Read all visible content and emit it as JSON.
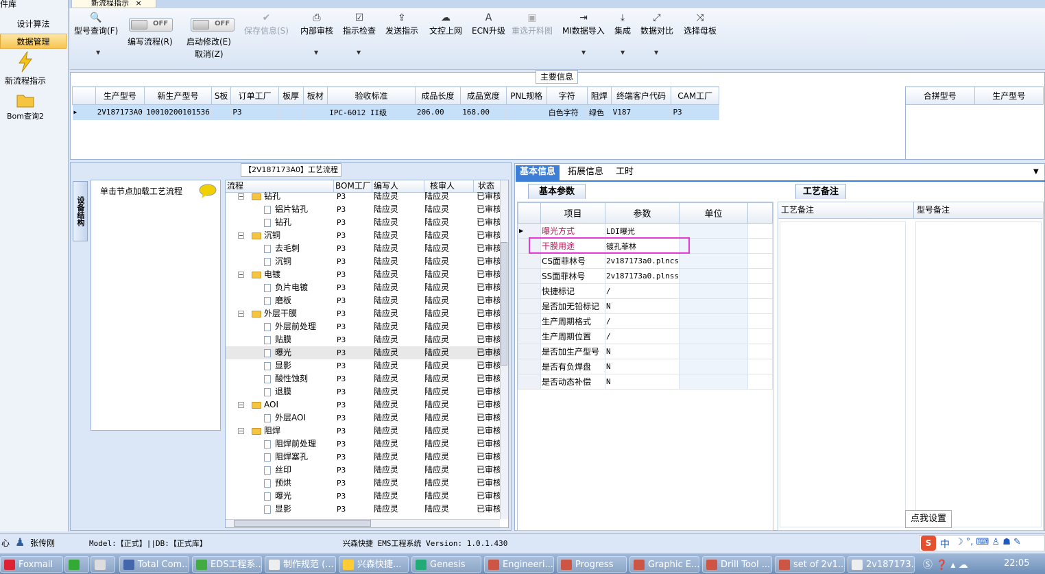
{
  "left_nav": {
    "title": "件库",
    "items": [
      {
        "label": "设计算法"
      },
      {
        "label": "数据管理"
      }
    ],
    "new_flow_label": "新流程指示",
    "bom_label": "Bom查询2"
  },
  "tab": {
    "label": "新流程指示",
    "close": "×"
  },
  "toolbar": {
    "model_query": "型号查询(F)",
    "edit_flow": "编写流程(R)",
    "off_label": "OFF",
    "start_modify": "启动修改(E)",
    "cancel": "取消(Z)",
    "save_info": "保存信息(S)",
    "internal_review": "内部审核",
    "check_instruction": "指示检查",
    "send_instruction": "发送指示",
    "doc_upload": "文控上网",
    "ecn_upgrade": "ECN升级",
    "reselect_material": "重选开料图",
    "mi_import": "MI数据导入",
    "integrate": "集成",
    "data_compare": "数据对比",
    "select_master": "选择母板"
  },
  "main_info": {
    "legend": "主要信息",
    "columns": [
      "生产型号",
      "新生产型号",
      "S板",
      "订单工厂",
      "板厚",
      "板材",
      "验收标准",
      "成品长度",
      "成品宽度",
      "PNL规格",
      "字符",
      "阻焊",
      "终端客户代码",
      "CAM工厂"
    ],
    "row": [
      "2V187173A0",
      "10010200101536",
      "",
      "P3",
      "",
      "",
      "IPC-6012 II级",
      "206.00",
      "168.00",
      "",
      "白色字符",
      "绿色",
      "V187",
      "P3"
    ],
    "right_columns": [
      "合拼型号",
      "生产型号"
    ]
  },
  "flow": {
    "legend": "【2V187173A0】工艺流程",
    "device_tab": "设备结构",
    "node_hint": "单击节点加载工艺流程",
    "headers": [
      "流程",
      "BOM工厂",
      "编写人",
      "核审人",
      "状态"
    ],
    "rows": [
      {
        "name": "钻孔",
        "level": 0,
        "folder": true,
        "f": "P3",
        "w": "陆应灵",
        "r": "陆应灵",
        "s": "已审核"
      },
      {
        "name": "铝片钻孔",
        "level": 1,
        "folder": false,
        "f": "P3",
        "w": "陆应灵",
        "r": "陆应灵",
        "s": "已审核"
      },
      {
        "name": "钻孔",
        "level": 1,
        "folder": false,
        "f": "P3",
        "w": "陆应灵",
        "r": "陆应灵",
        "s": "已审核"
      },
      {
        "name": "沉铜",
        "level": 0,
        "folder": true,
        "f": "P3",
        "w": "陆应灵",
        "r": "陆应灵",
        "s": "已审核"
      },
      {
        "name": "去毛刺",
        "level": 1,
        "folder": false,
        "f": "P3",
        "w": "陆应灵",
        "r": "陆应灵",
        "s": "已审核"
      },
      {
        "name": "沉铜",
        "level": 1,
        "folder": false,
        "f": "P3",
        "w": "陆应灵",
        "r": "陆应灵",
        "s": "已审核"
      },
      {
        "name": "电镀",
        "level": 0,
        "folder": true,
        "f": "P3",
        "w": "陆应灵",
        "r": "陆应灵",
        "s": "已审核"
      },
      {
        "name": "负片电镀",
        "level": 1,
        "folder": false,
        "f": "P3",
        "w": "陆应灵",
        "r": "陆应灵",
        "s": "已审核"
      },
      {
        "name": "磨板",
        "level": 1,
        "folder": false,
        "f": "P3",
        "w": "陆应灵",
        "r": "陆应灵",
        "s": "已审核"
      },
      {
        "name": "外层干膜",
        "level": 0,
        "folder": true,
        "f": "P3",
        "w": "陆应灵",
        "r": "陆应灵",
        "s": "已审核"
      },
      {
        "name": "外层前处理",
        "level": 1,
        "folder": false,
        "f": "P3",
        "w": "陆应灵",
        "r": "陆应灵",
        "s": "已审核"
      },
      {
        "name": "贴膜",
        "level": 1,
        "folder": false,
        "f": "P3",
        "w": "陆应灵",
        "r": "陆应灵",
        "s": "已审核"
      },
      {
        "name": "曝光",
        "level": 1,
        "folder": false,
        "f": "P3",
        "w": "陆应灵",
        "r": "陆应灵",
        "s": "已审核",
        "selected": true
      },
      {
        "name": "显影",
        "level": 1,
        "folder": false,
        "f": "P3",
        "w": "陆应灵",
        "r": "陆应灵",
        "s": "已审核"
      },
      {
        "name": "酸性蚀刻",
        "level": 1,
        "folder": false,
        "f": "P3",
        "w": "陆应灵",
        "r": "陆应灵",
        "s": "已审核"
      },
      {
        "name": "退膜",
        "level": 1,
        "folder": false,
        "f": "P3",
        "w": "陆应灵",
        "r": "陆应灵",
        "s": "已审核"
      },
      {
        "name": "AOI",
        "level": 0,
        "folder": true,
        "f": "P3",
        "w": "陆应灵",
        "r": "陆应灵",
        "s": "已审核"
      },
      {
        "name": "外层AOI",
        "level": 1,
        "folder": false,
        "f": "P3",
        "w": "陆应灵",
        "r": "陆应灵",
        "s": "已审核"
      },
      {
        "name": "阻焊",
        "level": 0,
        "folder": true,
        "f": "P3",
        "w": "陆应灵",
        "r": "陆应灵",
        "s": "已审核"
      },
      {
        "name": "阻焊前处理",
        "level": 1,
        "folder": false,
        "f": "P3",
        "w": "陆应灵",
        "r": "陆应灵",
        "s": "已审核"
      },
      {
        "name": "阻焊塞孔",
        "level": 1,
        "folder": false,
        "f": "P3",
        "w": "陆应灵",
        "r": "陆应灵",
        "s": "已审核"
      },
      {
        "name": "丝印",
        "level": 1,
        "folder": false,
        "f": "P3",
        "w": "陆应灵",
        "r": "陆应灵",
        "s": "已审核"
      },
      {
        "name": "预烘",
        "level": 1,
        "folder": false,
        "f": "P3",
        "w": "陆应灵",
        "r": "陆应灵",
        "s": "已审核"
      },
      {
        "name": "曝光",
        "level": 1,
        "folder": false,
        "f": "P3",
        "w": "陆应灵",
        "r": "陆应灵",
        "s": "已审核"
      },
      {
        "name": "显影",
        "level": 1,
        "folder": false,
        "f": "P3",
        "w": "陆应灵",
        "r": "陆应灵",
        "s": "已审核"
      }
    ]
  },
  "right_tabs": [
    "基本信息",
    "拓展信息",
    "工时"
  ],
  "basic_params": {
    "group": "基本参数",
    "headers": [
      "项目",
      "参数",
      "单位"
    ],
    "rows": [
      {
        "item": "曝光方式",
        "value": "LDI曝光",
        "unit": "",
        "red": true
      },
      {
        "item": "干膜用途",
        "value": "镀孔菲林",
        "unit": "",
        "red": true
      },
      {
        "item": "CS面菲林号",
        "value": "2v187173a0.plncs",
        "unit": ""
      },
      {
        "item": "SS面菲林号",
        "value": "2v187173a0.plnss",
        "unit": ""
      },
      {
        "item": "快捷标记",
        "value": "/",
        "unit": ""
      },
      {
        "item": "是否加无铅标记",
        "value": "N",
        "unit": ""
      },
      {
        "item": "生产周期格式",
        "value": "/",
        "unit": ""
      },
      {
        "item": "生产周期位置",
        "value": "/",
        "unit": ""
      },
      {
        "item": "是否加生产型号",
        "value": "N",
        "unit": ""
      },
      {
        "item": "是否有负焊盘",
        "value": "N",
        "unit": ""
      },
      {
        "item": "是否动态补偿",
        "value": "N",
        "unit": ""
      }
    ]
  },
  "process_notes": {
    "group": "工艺备注",
    "headers": [
      "工艺备注",
      "型号备注"
    ]
  },
  "tooltip": "点我设置",
  "status": {
    "left": "心",
    "user": "张传刚",
    "model_db": "Model:【正式】||DB:【正式库】",
    "system": "兴森快捷 EMS工程系统 Version: 1.0.1.430"
  },
  "taskbar": {
    "items": [
      "Foxmail",
      "",
      "",
      "Total Com...",
      "EDS工程系...",
      "制作规范 (...",
      "兴森快捷...",
      "Genesis",
      "Engineeri...",
      "Progress",
      "Graphic E...",
      "Drill Tool ...",
      "set of 2v1...",
      "2v187173..."
    ],
    "ime": "中",
    "clock": "22:05"
  },
  "colors": {
    "accent": "#3d7fd6",
    "highlight": "#e33ad8",
    "selected_row": "#c7e0fa",
    "red_text": "#c0185a"
  }
}
